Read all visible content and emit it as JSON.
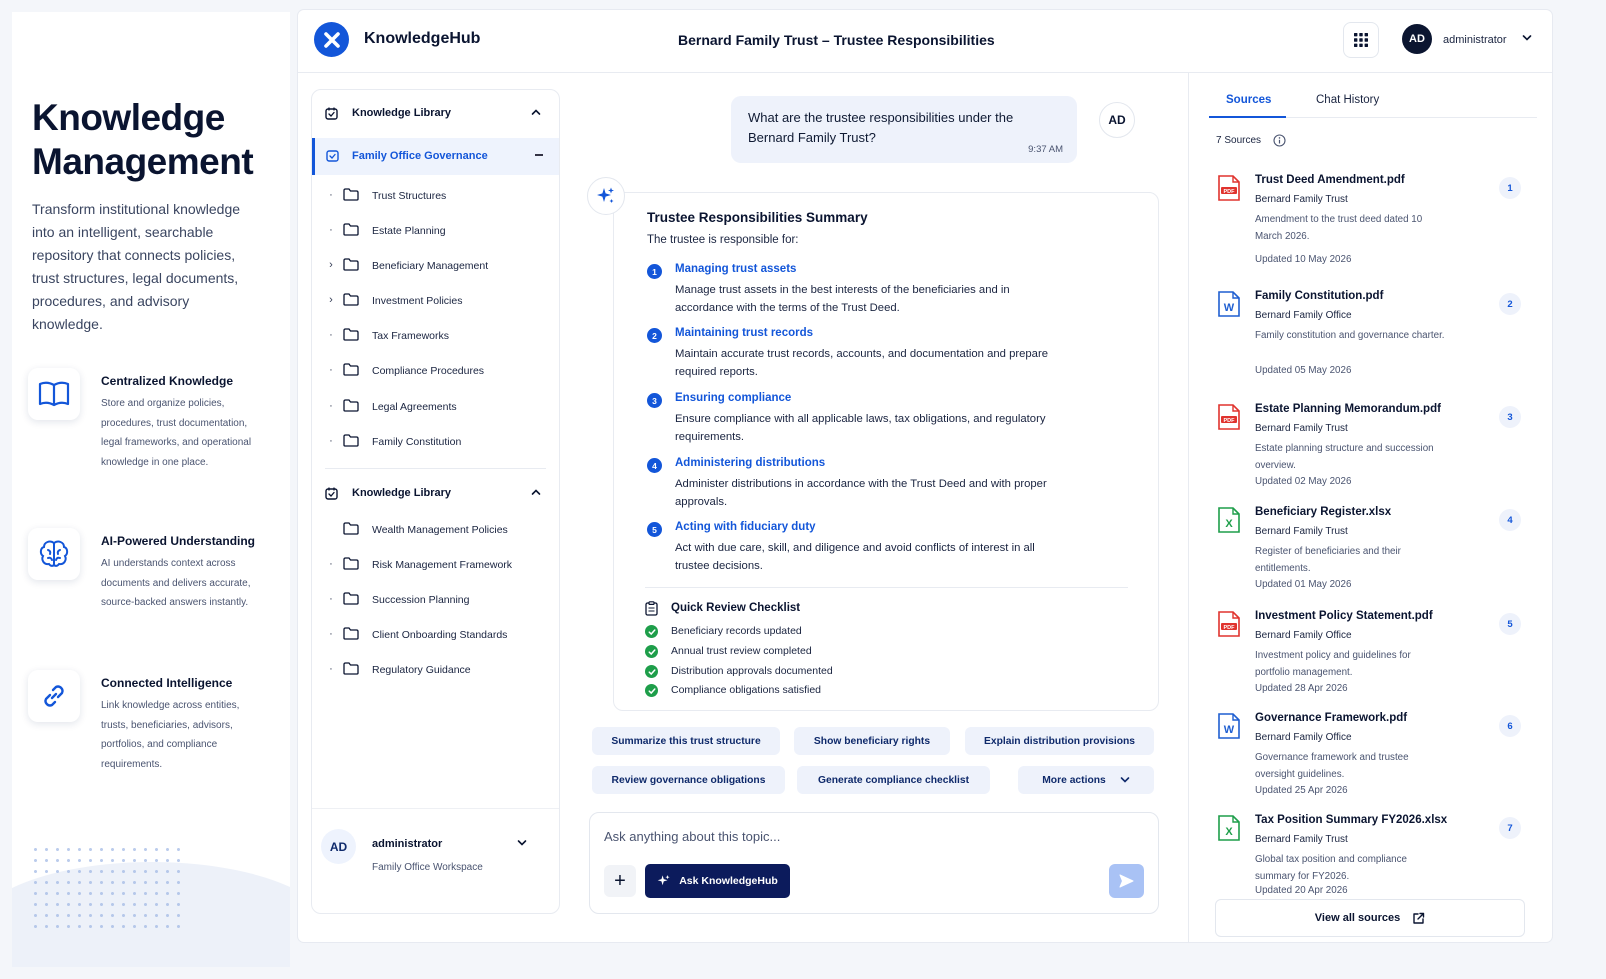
{
  "promo": {
    "title_line1": "Knowledge",
    "title_line2": "Management",
    "lead": "Transform institutional knowledge into an intelligent, searchable repository that connects policies, trust structures, legal documents, procedures, and advisory knowledge.",
    "features": [
      {
        "icon": "open-book-icon",
        "title": "Centralized Knowledge",
        "desc": "Store and organize policies, procedures, trust documentation, legal frameworks, and operational knowledge in one place."
      },
      {
        "icon": "brain-icon",
        "title": "AI-Powered Understanding",
        "desc": "AI understands context across documents and delivers accurate, source-backed answers instantly."
      },
      {
        "icon": "link-icon",
        "title": "Connected Intelligence",
        "desc": "Link knowledge across entities, trusts, beneficiaries, advisors, portfolios, and compliance requirements."
      }
    ]
  },
  "header": {
    "brand": "KnowledgeHub",
    "doc_title": "Bernard Family Trust – Trustee Responsibilities",
    "user_initials": "AD",
    "user_name": "administrator"
  },
  "library": {
    "section1_title": "Knowledge Library",
    "active_folder": "Family Office Governance",
    "section1_folders": [
      {
        "label": "Trust Structures",
        "expandable": false
      },
      {
        "label": "Estate Planning",
        "expandable": false
      },
      {
        "label": "Beneficiary Management",
        "expandable": true
      },
      {
        "label": "Investment Policies",
        "expandable": true
      },
      {
        "label": "Tax Frameworks",
        "expandable": false
      },
      {
        "label": "Compliance Procedures",
        "expandable": false
      },
      {
        "label": "Legal Agreements",
        "expandable": false
      },
      {
        "label": "Family Constitution",
        "expandable": false
      }
    ],
    "section2_title": "Knowledge Library",
    "section2_folders": [
      {
        "label": "Wealth Management Policies"
      },
      {
        "label": "Risk Management Framework"
      },
      {
        "label": "Succession Planning"
      },
      {
        "label": "Client Onboarding Standards"
      },
      {
        "label": "Regulatory Guidance"
      }
    ],
    "user": {
      "initials": "AD",
      "name": "administrator",
      "workspace": "Family Office Workspace"
    }
  },
  "chat": {
    "question": "What are the trustee responsibilities under the Bernard Family Trust?",
    "question_time": "9:37 AM",
    "user_initials": "AD",
    "answer": {
      "title": "Trustee Responsibilities Summary",
      "intro": "The trustee is responsible for:",
      "items": [
        {
          "num": "1",
          "title": "Managing trust assets",
          "desc": "Manage trust assets in the best interests of the beneficiaries and in accordance with the terms of the Trust Deed."
        },
        {
          "num": "2",
          "title": "Maintaining trust records",
          "desc": "Maintain accurate trust records, accounts, and documentation and prepare required reports."
        },
        {
          "num": "3",
          "title": "Ensuring compliance",
          "desc": "Ensure compliance with all applicable laws, tax obligations, and regulatory requirements."
        },
        {
          "num": "4",
          "title": "Administering distributions",
          "desc": "Administer distributions in accordance with the Trust Deed and with proper approvals."
        },
        {
          "num": "5",
          "title": "Acting with fiduciary duty",
          "desc": "Act with due care, skill, and diligence and avoid conflicts of interest in all trustee decisions."
        }
      ],
      "checklist_title": "Quick Review Checklist",
      "checklist": [
        "Beneficiary records updated",
        "Annual trust review completed",
        "Distribution approvals documented",
        "Compliance obligations satisfied"
      ]
    },
    "suggestions_row1": [
      "Summarize this trust structure",
      "Show beneficiary rights",
      "Explain distribution provisions"
    ],
    "suggestions_row2": [
      "Review governance obligations",
      "Generate compliance checklist",
      "More actions"
    ],
    "composer_placeholder": "Ask anything about this topic...",
    "ask_label": "Ask KnowledgeHub"
  },
  "sources": {
    "tab_sources": "Sources",
    "tab_history": "Chat History",
    "count": "7 Sources",
    "items": [
      {
        "type": "pdf",
        "name": "Trust Deed Amendment.pdf",
        "owner": "Bernard Family Trust",
        "desc": "Amendment to the trust deed dated 10 March 2026.",
        "updated": "Updated 10 May 2026",
        "index": "1"
      },
      {
        "type": "word",
        "name": "Family Constitution.pdf",
        "owner": "Bernard Family Office",
        "desc": "Family constitution and governance charter.",
        "updated": "Updated 05 May 2026",
        "index": "2"
      },
      {
        "type": "pdf",
        "name": "Estate Planning Memorandum.pdf",
        "owner": "Bernard Family Trust",
        "desc": "Estate planning structure and succession overview.",
        "updated": "Updated 02 May 2026",
        "index": "3"
      },
      {
        "type": "excel",
        "name": "Beneficiary Register.xlsx",
        "owner": "Bernard Family Trust",
        "desc": "Register of beneficiaries and their entitlements.",
        "updated": "Updated 01 May 2026",
        "index": "4"
      },
      {
        "type": "pdf",
        "name": "Investment Policy Statement.pdf",
        "owner": "Bernard Family Office",
        "desc": "Investment policy and guidelines for portfolio management.",
        "updated": "Updated 28 Apr 2026",
        "index": "5"
      },
      {
        "type": "word",
        "name": "Governance Framework.pdf",
        "owner": "Bernard Family Office",
        "desc": "Governance framework and trustee oversight guidelines.",
        "updated": "Updated 25 Apr 2026",
        "index": "6"
      },
      {
        "type": "excel",
        "name": "Tax Position Summary FY2026.xlsx",
        "owner": "Bernard Family Trust",
        "desc": "Global tax position and compliance summary for FY2026.",
        "updated": "Updated 20 Apr 2026",
        "index": "7"
      }
    ],
    "view_all": "View all sources"
  },
  "colors": {
    "accent": "#1356d9",
    "navy": "#0c1b5c",
    "success": "#1e9e4a",
    "pdf": "#e0332e",
    "word": "#1f5fd1",
    "excel": "#1e9e4a"
  }
}
